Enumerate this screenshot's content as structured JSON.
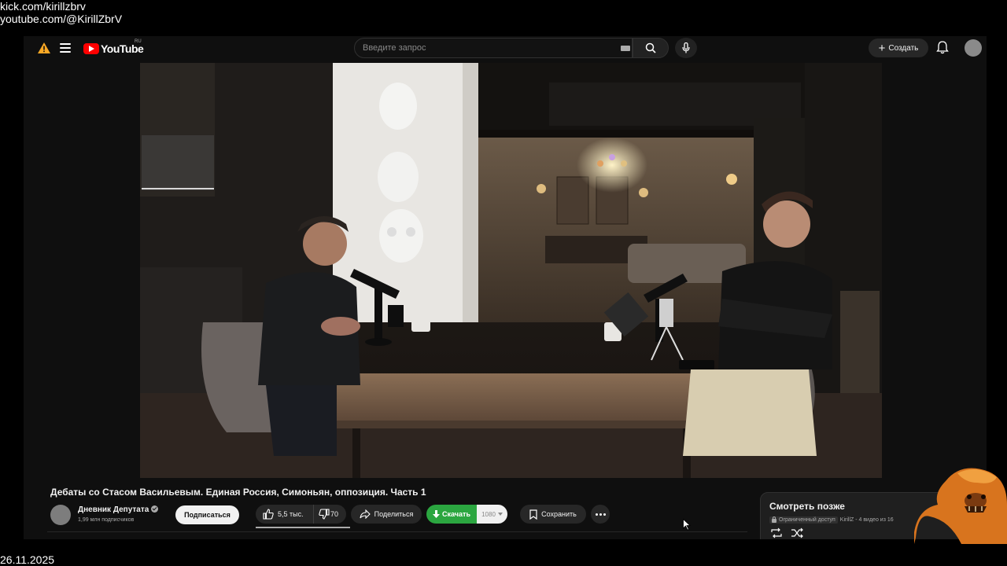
{
  "overlay": {
    "line1": "kick.com/kirillzbrv",
    "line2": "youtube.com/@KirillZbrV",
    "date": "26.11.2025"
  },
  "topbar": {
    "logo_text": "YouTube",
    "region": "RU",
    "search_placeholder": "Введите запрос",
    "create_label": "Создать",
    "icons": [
      "warning-icon",
      "menu-icon",
      "keyboard-icon",
      "search-icon",
      "mic-icon",
      "plus-icon",
      "bell-icon"
    ]
  },
  "video": {
    "title": "Дебаты со Стасом Васильевым. Единая Россия, Симоньян, оппозиция. Часть 1",
    "channel_name": "Дневник Депутата",
    "subscribers": "1,99 млн подписчиков",
    "subscribe_label": "Подписаться",
    "likes": "5,5 тыс.",
    "dislikes": "70",
    "share_label": "Поделиться",
    "download_label": "Скачать",
    "quality": "1080",
    "save_label": "Сохранить"
  },
  "watch_later": {
    "title": "Смотреть позже",
    "access": "Ограниченный доступ",
    "meta": "KirillZ - 4 видео из 16"
  },
  "colors": {
    "background": "#0f0f0f",
    "accent_red": "#ff0000",
    "download_green": "#2ba640",
    "warning_orange": "#f9a825"
  }
}
